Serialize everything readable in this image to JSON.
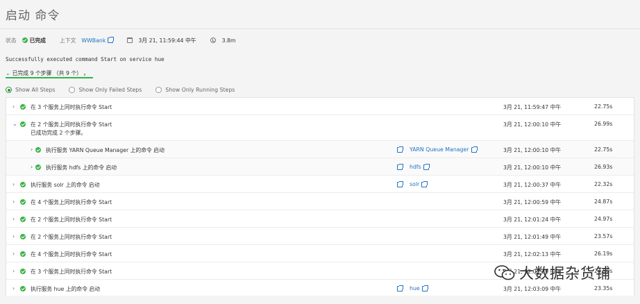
{
  "page": {
    "title": "启动 命令"
  },
  "status": {
    "label": "状态",
    "value": "已完成",
    "context_label": "上下文",
    "context_link": "WWBank",
    "date": "3月 21, 11:59:44 中午",
    "duration": "3.8m"
  },
  "message": "Successfully executed command Start on service hue",
  "summary": "已完成 9 个步骤 （共 9 个） 。",
  "filters": [
    {
      "label": "Show All Steps",
      "selected": true
    },
    {
      "label": "Show Only Failed Steps",
      "selected": false
    },
    {
      "label": "Show Only Running Steps",
      "selected": false
    }
  ],
  "steps": [
    {
      "name": "在 3 个服务上同时执行命令 Start",
      "link": "",
      "date": "3月 21, 11:59:47 中午",
      "duration": "22.75s",
      "expanded": false
    },
    {
      "name": "在 2 个服务上同时执行命令 Start",
      "sub": "已成功完成 2 个步骤。",
      "link": "",
      "date": "3月 21, 12:00:10 中午",
      "duration": "26.99s",
      "expanded": true
    },
    {
      "name": "执行服务 YARN Queue Manager 上的命令 启动",
      "link": "YARN Queue Manager",
      "date": "3月 21, 12:00:10 中午",
      "duration": "22.75s",
      "child": true
    },
    {
      "name": "执行服务 hdfs 上的命令 启动",
      "link": "hdfs",
      "date": "3月 21, 12:00:10 中午",
      "duration": "26.93s",
      "child": true
    },
    {
      "name": "执行服务 solr 上的命令 启动",
      "link": "solr",
      "date": "3月 21, 12:00:37 中午",
      "duration": "22.32s"
    },
    {
      "name": "在 4 个服务上同时执行命令 Start",
      "link": "",
      "date": "3月 21, 12:00:59 中午",
      "duration": "24.87s"
    },
    {
      "name": "在 2 个服务上同时执行命令 Start",
      "link": "",
      "date": "3月 21, 12:01:24 中午",
      "duration": "24.97s"
    },
    {
      "name": "在 2 个服务上同时执行命令 Start",
      "link": "",
      "date": "3月 21, 12:01:49 中午",
      "duration": "23.57s"
    },
    {
      "name": "在 4 个服务上同时执行命令 Start",
      "link": "",
      "date": "3月 21, 12:02:13 中午",
      "duration": "26.19s"
    },
    {
      "name": "在 3 个服务上同时执行命令 Start",
      "link": "",
      "date": "3月 21, 12:02:39 中午",
      "duration": "24.50s"
    },
    {
      "name": "执行服务 hue 上的命令 启动",
      "link": "hue",
      "date": "3月 21, 12:03:09 中午",
      "duration": "23.35s"
    }
  ],
  "watermark": "大数据杂货铺",
  "colors": {
    "success": "#3db24a",
    "link": "#1f72c2",
    "underline": "#2db54a"
  }
}
